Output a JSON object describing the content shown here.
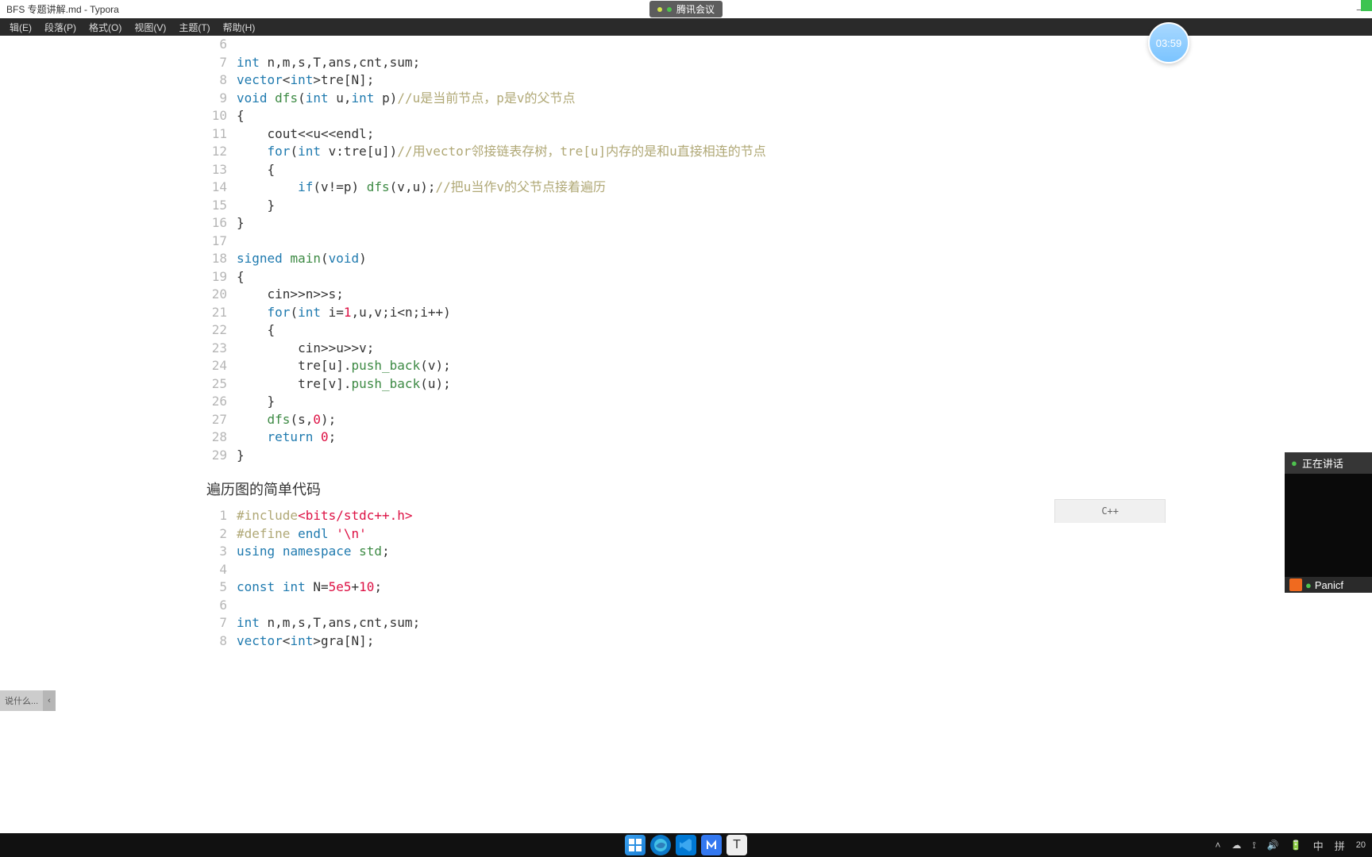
{
  "window": {
    "title": "BFS 专题讲解.md - Typora",
    "meeting_label": "腾讯会议"
  },
  "menu": {
    "items": [
      "辑(E)",
      "段落(P)",
      "格式(O)",
      "视图(V)",
      "主题(T)",
      "帮助(H)"
    ]
  },
  "timer": "03:59",
  "speaking": {
    "label": "正在讲话",
    "user": "Panicf"
  },
  "outline": "说什么...",
  "code_block_1": {
    "lang": "C++",
    "start": 6,
    "lines": [
      {
        "n": 6,
        "segs": []
      },
      {
        "n": 7,
        "segs": [
          {
            "t": "int",
            "c": "ty"
          },
          {
            "t": " n,m,s,T,ans,cnt,sum;"
          }
        ]
      },
      {
        "n": 8,
        "segs": [
          {
            "t": "vector",
            "c": "ty"
          },
          {
            "t": "<"
          },
          {
            "t": "int",
            "c": "ty"
          },
          {
            "t": ">tre[N];"
          }
        ]
      },
      {
        "n": 9,
        "segs": [
          {
            "t": "void",
            "c": "kw"
          },
          {
            "t": " "
          },
          {
            "t": "dfs",
            "c": "fn"
          },
          {
            "t": "("
          },
          {
            "t": "int",
            "c": "ty"
          },
          {
            "t": " u,"
          },
          {
            "t": "int",
            "c": "ty"
          },
          {
            "t": " p)"
          },
          {
            "t": "//u是当前节点，p是v的父节点",
            "c": "cm"
          }
        ]
      },
      {
        "n": 10,
        "segs": [
          {
            "t": "{"
          }
        ]
      },
      {
        "n": 11,
        "segs": [
          {
            "t": "    cout<<u<<endl;"
          }
        ]
      },
      {
        "n": 12,
        "segs": [
          {
            "t": "    "
          },
          {
            "t": "for",
            "c": "kw"
          },
          {
            "t": "("
          },
          {
            "t": "int",
            "c": "ty"
          },
          {
            "t": " v:tre[u])"
          },
          {
            "t": "//用vector邻接链表存树，tre[u]内存的是和u直接相连的节点",
            "c": "cm"
          }
        ]
      },
      {
        "n": 13,
        "segs": [
          {
            "t": "    {"
          }
        ]
      },
      {
        "n": 14,
        "segs": [
          {
            "t": "        "
          },
          {
            "t": "if",
            "c": "kw"
          },
          {
            "t": "(v!=p) "
          },
          {
            "t": "dfs",
            "c": "fn"
          },
          {
            "t": "(v,u);"
          },
          {
            "t": "//把u当作v的父节点接着遍历",
            "c": "cm"
          }
        ]
      },
      {
        "n": 15,
        "segs": [
          {
            "t": "    }"
          }
        ]
      },
      {
        "n": 16,
        "segs": [
          {
            "t": "}"
          }
        ]
      },
      {
        "n": 17,
        "segs": []
      },
      {
        "n": 18,
        "segs": [
          {
            "t": "signed",
            "c": "kw"
          },
          {
            "t": " "
          },
          {
            "t": "main",
            "c": "fn"
          },
          {
            "t": "("
          },
          {
            "t": "void",
            "c": "kw"
          },
          {
            "t": ")"
          }
        ]
      },
      {
        "n": 19,
        "segs": [
          {
            "t": "{"
          }
        ]
      },
      {
        "n": 20,
        "segs": [
          {
            "t": "    cin>>n>>s;"
          }
        ]
      },
      {
        "n": 21,
        "segs": [
          {
            "t": "    "
          },
          {
            "t": "for",
            "c": "kw"
          },
          {
            "t": "("
          },
          {
            "t": "int",
            "c": "ty"
          },
          {
            "t": " i="
          },
          {
            "t": "1",
            "c": "num"
          },
          {
            "t": ",u,v;i<n;i++)"
          }
        ]
      },
      {
        "n": 22,
        "segs": [
          {
            "t": "    {"
          }
        ]
      },
      {
        "n": 23,
        "segs": [
          {
            "t": "        cin>>u>>v;"
          }
        ]
      },
      {
        "n": 24,
        "segs": [
          {
            "t": "        tre[u]."
          },
          {
            "t": "push_back",
            "c": "fn"
          },
          {
            "t": "(v);"
          }
        ]
      },
      {
        "n": 25,
        "segs": [
          {
            "t": "        tre[v]."
          },
          {
            "t": "push_back",
            "c": "fn"
          },
          {
            "t": "(u);"
          }
        ]
      },
      {
        "n": 26,
        "segs": [
          {
            "t": "    }"
          }
        ]
      },
      {
        "n": 27,
        "segs": [
          {
            "t": "    "
          },
          {
            "t": "dfs",
            "c": "fn"
          },
          {
            "t": "(s,"
          },
          {
            "t": "0",
            "c": "num"
          },
          {
            "t": ");"
          }
        ]
      },
      {
        "n": 28,
        "segs": [
          {
            "t": "    "
          },
          {
            "t": "return",
            "c": "kw"
          },
          {
            "t": " "
          },
          {
            "t": "0",
            "c": "num"
          },
          {
            "t": ";"
          }
        ]
      },
      {
        "n": 29,
        "segs": [
          {
            "t": "}"
          }
        ]
      }
    ]
  },
  "section_heading": "遍历图的简单代码",
  "code_block_2": {
    "lang": "C++",
    "lines": [
      {
        "n": 1,
        "segs": [
          {
            "t": "#include",
            "c": "pp"
          },
          {
            "t": "<bits/stdc++.h>",
            "c": "str"
          }
        ]
      },
      {
        "n": 2,
        "segs": [
          {
            "t": "#define",
            "c": "pp"
          },
          {
            "t": " "
          },
          {
            "t": "endl",
            "c": "pk"
          },
          {
            "t": " "
          },
          {
            "t": "'\\n'",
            "c": "str"
          }
        ]
      },
      {
        "n": 3,
        "segs": [
          {
            "t": "using",
            "c": "kw"
          },
          {
            "t": " "
          },
          {
            "t": "namespace",
            "c": "kw"
          },
          {
            "t": " "
          },
          {
            "t": "std",
            "c": "fn"
          },
          {
            "t": ";"
          }
        ]
      },
      {
        "n": 4,
        "segs": []
      },
      {
        "n": 5,
        "segs": [
          {
            "t": "const",
            "c": "kw"
          },
          {
            "t": " "
          },
          {
            "t": "int",
            "c": "ty"
          },
          {
            "t": " N="
          },
          {
            "t": "5e5",
            "c": "num"
          },
          {
            "t": "+"
          },
          {
            "t": "10",
            "c": "num"
          },
          {
            "t": ";"
          }
        ]
      },
      {
        "n": 6,
        "segs": []
      },
      {
        "n": 7,
        "segs": [
          {
            "t": "int",
            "c": "ty"
          },
          {
            "t": " n,m,s,T,ans,cnt,sum;"
          }
        ]
      },
      {
        "n": 8,
        "segs": [
          {
            "t": "vector",
            "c": "ty"
          },
          {
            "t": "<"
          },
          {
            "t": "int",
            "c": "ty"
          },
          {
            "t": ">gra[N];"
          }
        ]
      }
    ]
  },
  "tray": {
    "ime1": "中",
    "ime2": "拼",
    "clock": "20"
  }
}
